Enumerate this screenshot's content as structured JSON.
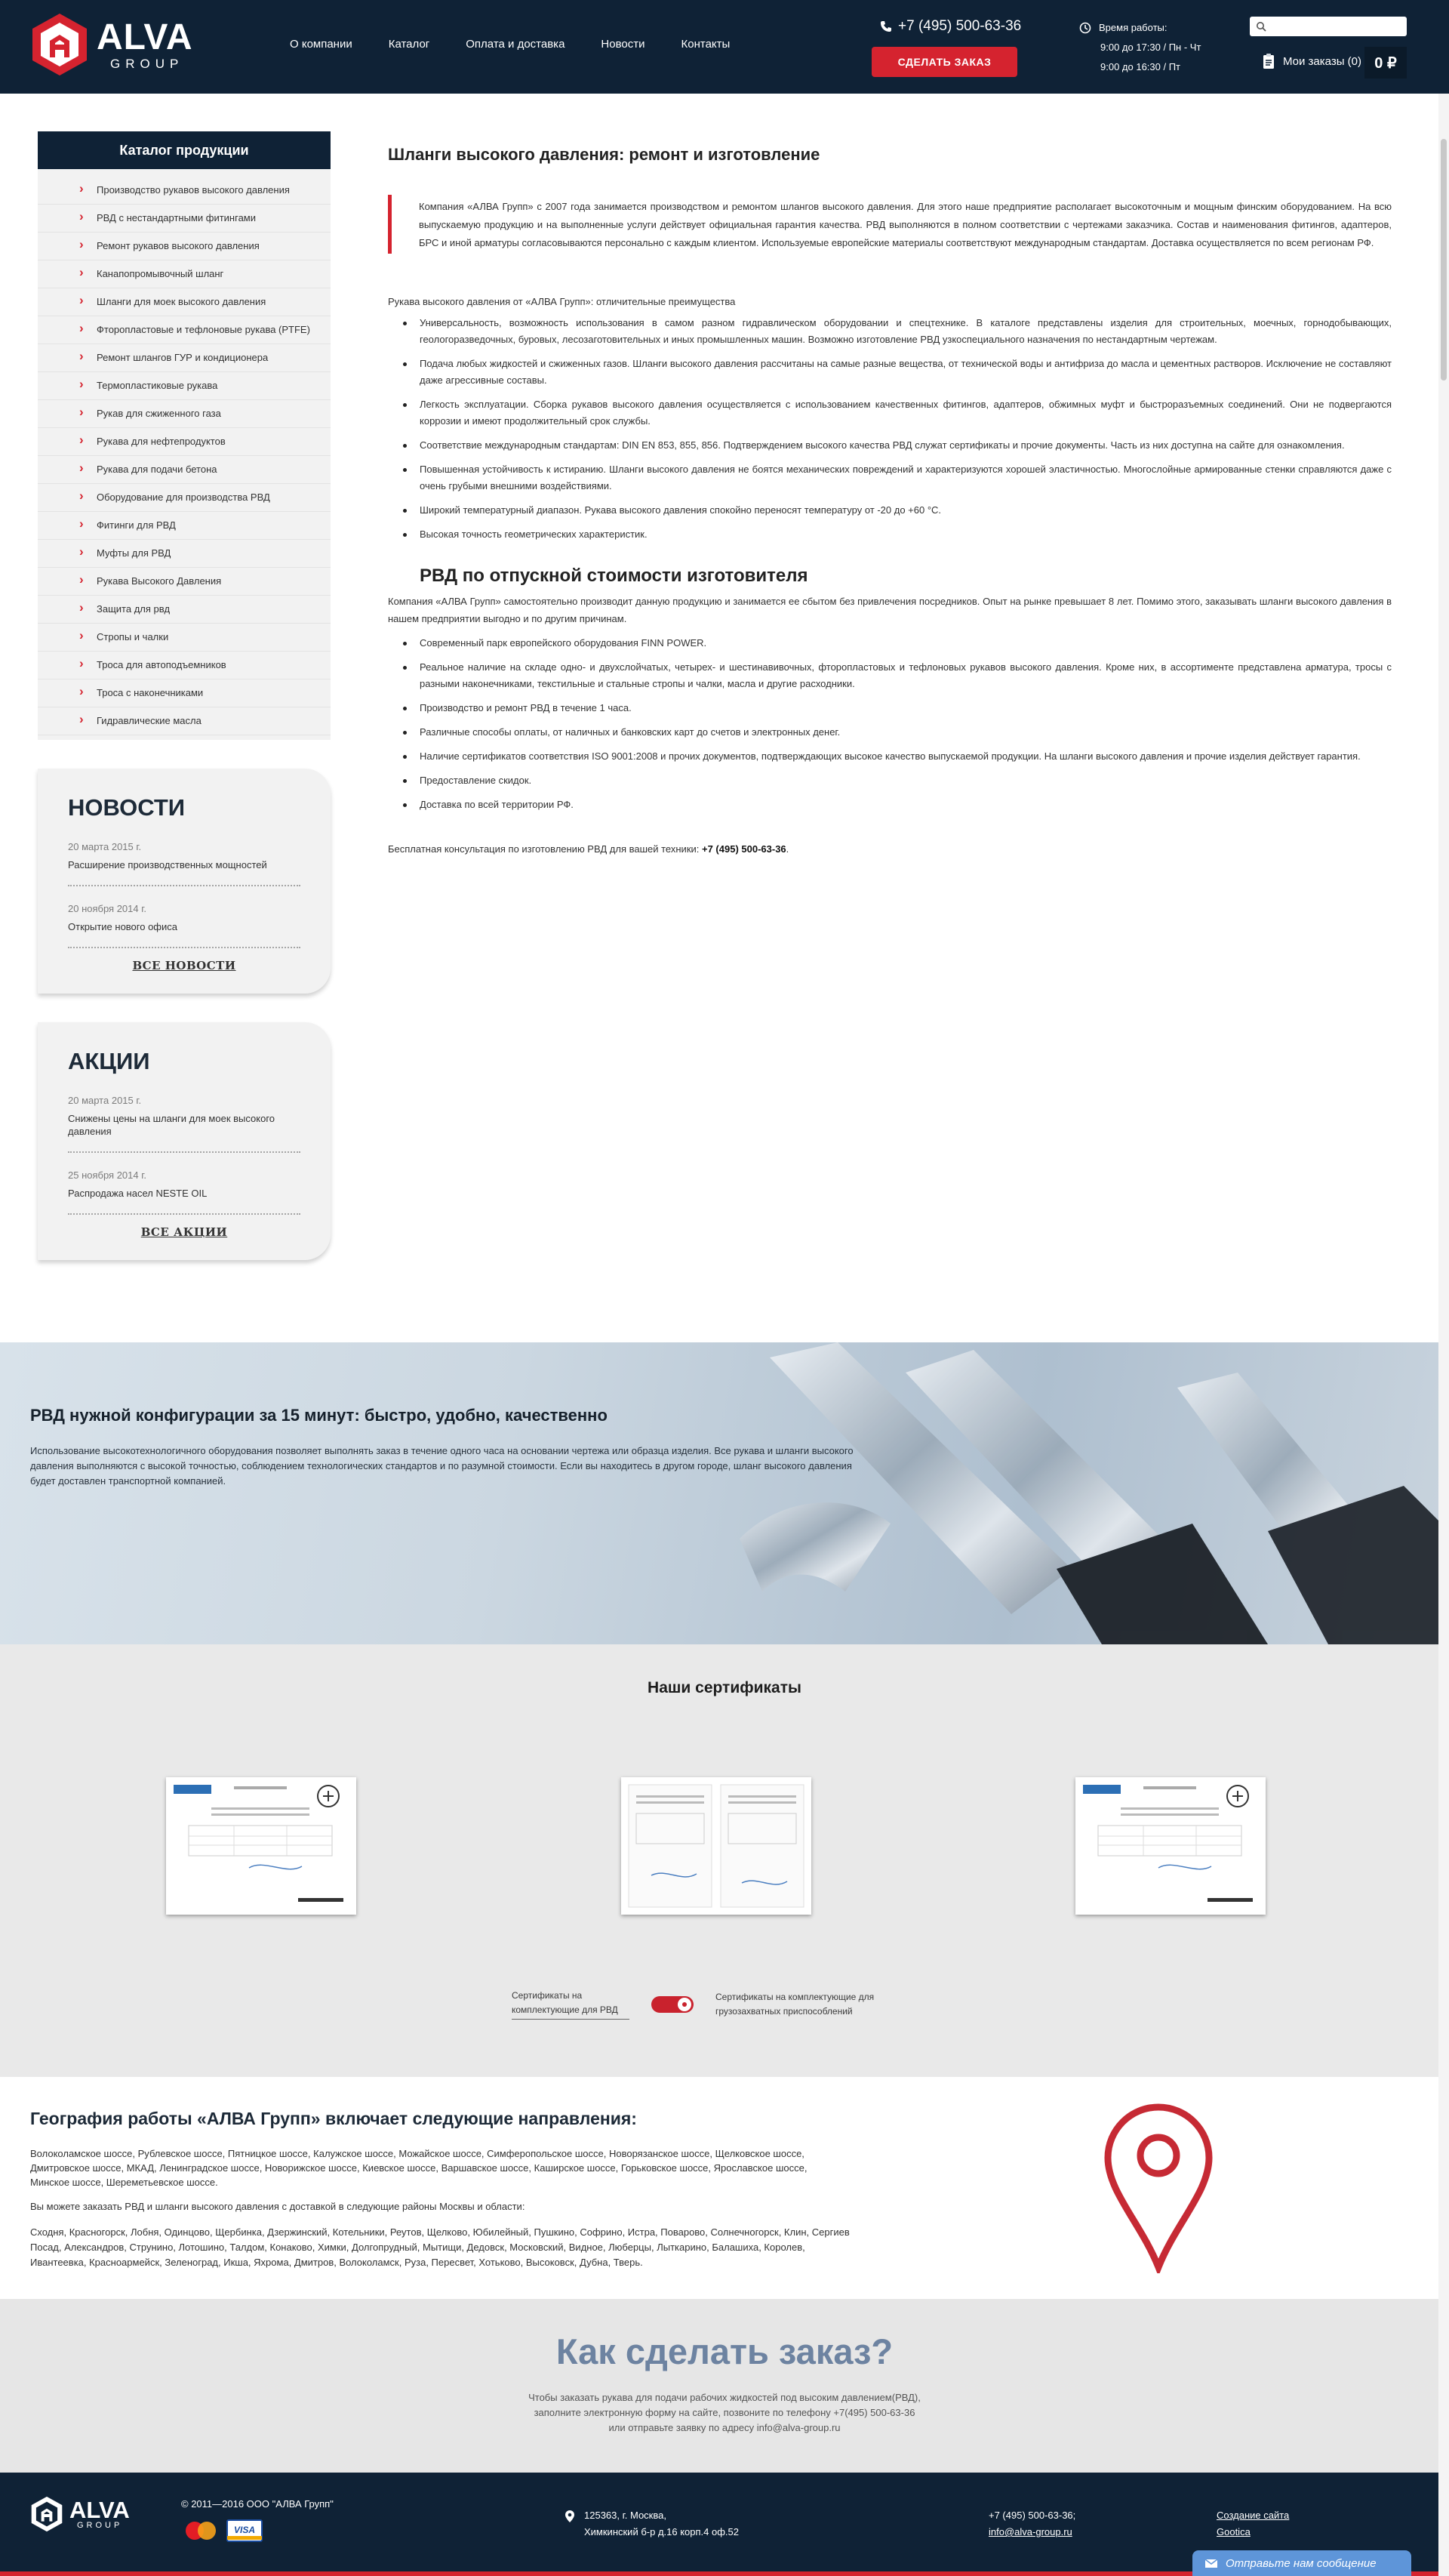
{
  "header": {
    "logo_main": "ALVA",
    "logo_sub": "GROUP",
    "nav": [
      "О компании",
      "Каталог",
      "Оплата и доставка",
      "Новости",
      "Контакты"
    ],
    "phone": "+7 (495) 500-63-36",
    "order_button": "СДЕЛАТЬ ЗАКАЗ",
    "hours_title": "Время работы:",
    "hours": [
      "9:00 до 17:30 / Пн - Чт",
      "9:00 до 16:30 / Пт"
    ],
    "search_placeholder": "",
    "cart_label": "Мои заказы (0)",
    "cart_sum": "0 ₽"
  },
  "sidebar": {
    "catalog_title": "Каталог продукции",
    "catalog": [
      "Производство рукавов высокого давления",
      "РВД с нестандартными фитингами",
      "Ремонт рукавов высокого давления",
      "Канапопромывочный шланг",
      "Шланги для моек высокого давления",
      "Фторопластовые и тефлоновые рукава (PTFE)",
      "Ремонт шлангов ГУР и кондиционера",
      "Термопластиковые рукава",
      "Рукав для сжиженного газа",
      "Рукава для нефтепродуктов",
      "Рукава для подачи бетона",
      "Оборудование для производства РВД",
      "Фитинги для РВД",
      "Муфты для РВД",
      "Рукава Высокого Давления",
      "Защита для рвд",
      "Стропы и чалки",
      "Троса для автоподъемников",
      "Троса с наконечниками",
      "Гидравлические масла"
    ],
    "news_title": "НОВОСТИ",
    "news": [
      {
        "date": "20 марта 2015 г.",
        "text": "Расширение производственных мощностей"
      },
      {
        "date": "20 ноября 2014 г.",
        "text": "Открытие нового офиса"
      }
    ],
    "news_all": "ВСЕ НОВОСТИ",
    "promo_title": "АКЦИИ",
    "promos": [
      {
        "date": "20 марта 2015 г.",
        "text": "Снижены цены на шланги для моек высокого давления"
      },
      {
        "date": "25 ноября 2014 г.",
        "text": "Распродажа насел NESTE OIL"
      }
    ],
    "promo_all": "ВСЕ АКЦИИ"
  },
  "content": {
    "title": "Шланги высокого давления: ремонт и изготовление",
    "quote": "Компания «АЛВА Групп» с 2007 года занимается производством и ремонтом шлангов высокого давления. Для этого наше предприятие располагает высокоточным и мощным финским оборудованием. На всю выпускаемую продукцию и на выполненные услуги действует официальная гарантия качества. РВД выполняются в полном соответствии с чертежами заказчика. Состав и наименования фитингов, адаптеров, БРС и иной арматуры согласовываются персонально с каждым клиентом. Используемые европейские материалы соответствуют международным стандартам. Доставка осуществляется по всем регионам РФ.",
    "advantages_lead": "Рукава высокого давления от «АЛВА Групп»: отличительные преимущества",
    "advantages": [
      "Универсальность, возможность использования в самом разном гидравлическом оборудовании и спецтехнике. В каталоге представлены изделия для строительных, моечных, горнодобывающих, геологоразведочных, буровых, лесозаготовительных и иных промышленных машин. Возможно изготовление РВД узкоспециального назначения по нестандартным чертежам.",
      "Подача любых жидкостей и сжиженных газов. Шланги высокого давления рассчитаны на самые разные вещества, от технической воды и антифриза до масла и цементных растворов. Исключение не составляют даже агрессивные составы.",
      "Легкость эксплуатации. Сборка рукавов высокого давления осуществляется с использованием качественных фитингов, адаптеров, обжимных муфт и быстроразъемных соединений. Они не подвергаются коррозии и имеют продолжительный срок службы.",
      "Соответствие международным стандартам: DIN EN 853, 855, 856. Подтверждением высокого качества РВД служат сертификаты и прочие документы. Часть из них доступна на сайте для ознакомления.",
      "Повышенная устойчивость к истиранию. Шланги высокого давления не боятся механических повреждений и характеризуются хорошей эластичностью. Многослойные армированные стенки справляются даже с очень грубыми внешними воздействиями.",
      "Широкий температурный диапазон. Рукава высокого давления спокойно переносят температуру от -20 до +60 °С.",
      "Высокая точность геометрических характеристик."
    ],
    "subtitle": "РВД по отпускной стоимости изготовителя",
    "body": "Компания «АЛВА Групп» самостоятельно производит данную продукцию и занимается ее сбытом без привлечения посредников. Опыт на рынке превышает 8 лет. Помимо этого, заказывать шланги высокого давления в нашем предприятии выгодно и по другим причинам.",
    "reasons": [
      "Современный парк европейского оборудования FINN POWER.",
      "Реальное наличие на складе одно- и двухслойчатых, четырех- и шестинавивочных, фторопластовых и тефлоновых рукавов высокого давления. Кроме них, в ассортименте представлена арматура, тросы с разными наконечниками, текстильные и стальные стропы и чалки, масла и другие расходники.",
      "Производство и ремонт РВД в течение 1 часа.",
      "Различные способы оплаты, от наличных и банковских карт до счетов и электронных денег.",
      "Наличие сертификатов соответствия ISO 9001:2008 и прочих документов, подтверждающих высокое качество выпускаемой продукции. На шланги высокого давления и прочие изделия действует гарантия.",
      "Предоставление скидок.",
      "Доставка по всей территории РФ."
    ],
    "consult_text": "Бесплатная консультация по изготовлению РВД для вашей техники: ",
    "consult_phone": "+7 (495) 500-63-36",
    "consult_end": "."
  },
  "banner": {
    "title": "РВД нужной конфигурации за 15 минут: быстро, удобно, качественно",
    "text": "Использование высокотехнологичного оборудования позволяет выполнять заказ в течение одного часа на основании чертежа или образца изделия. Все рукава и шланги высокого давления выполняются с высокой точностью, соблюдением технологических стандартов и по разумной стоимости. Если вы находитесь в другом городе, шланг высокого давления будет доставлен транспортной компанией."
  },
  "certificates": {
    "title": "Наши сертификаты",
    "switch_left": "Сертификаты на комплектующие для РВД",
    "switch_right": "Сертификаты на комплектующие для грузозахватных приспособлений"
  },
  "geo": {
    "title": "География работы «АЛВА Групп» включает следующие направления:",
    "roads": "Волоколамское шоссе, Рублевское шоссе, Пятницкое шоссе, Калужское шоссе, Можайское шоссе, Симферопольское шоссе, Новорязанское шоссе, Щелковское шоссе, Дмитровское шоссе, МКАД, Ленинградское шоссе, Новорижское шоссе, Киевское шоссе, Варшавское шоссе, Каширское шоссе, Горьковское шоссе, Ярославское шоссе, Минское шоссе, Шереметьевское шоссе.",
    "delivery_lead": "Вы можете заказать РВД и шланги высокого давления с доставкой в следующие районы Москвы и области:",
    "cities": "Сходня, Красногорск, Лобня, Одинцово, Щербинка, Дзержинский, Котельники, Реутов, Щелково, Юбилейный, Пушкино, Софрино, Истра, Поварово, Солнечногорск, Клин, Сергиев Посад, Александров, Струнино, Лотошино, Талдом, Конаково, Химки, Долгопрудный, Мытищи, Дедовск, Московский, Видное, Люберцы, Лыткарино, Балашиха, Королев, Ивантеевка, Красноармейск, Зеленоград, Икша, Яхрома, Дмитров, Волоколамск, Руза, Пересвет, Хотьково, Высоковск, Дубна, Тверь."
  },
  "howto": {
    "title": "Как сделать заказ?",
    "lines": [
      "Чтобы заказать рукава для подачи рабочих жидкостей под высоким давлением(РВД),",
      "заполните электронную форму на сайте, позвоните по телефону +7(495) 500-63-36",
      "или отправьте заявку по адресу info@alva-group.ru"
    ]
  },
  "footer": {
    "logo_main": "ALVA",
    "logo_sub": "GROUP",
    "copyright": "© 2011—2016 ООО \"АЛВА Групп\"",
    "card_visa": "VISA",
    "address_1": "125363, г. Москва,",
    "address_2": "Химкинский б-р д.16 корп.4 оф.52",
    "phone": "+7 (495) 500-63-36;",
    "email": "info@alva-group.ru",
    "dev_1": "Создание сайта",
    "dev_2": "Gootica"
  },
  "chat_label": "Отправьте нам сообщение",
  "colors": {
    "navy": "#0f2236",
    "accent_red": "#d5232f",
    "howto_blue": "#6d83a1",
    "chat_blue": "#5e95d9"
  }
}
